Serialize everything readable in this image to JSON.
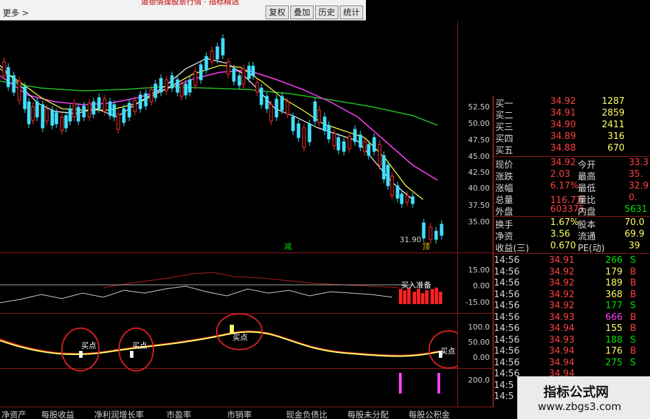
{
  "window": {
    "title": "道德情操股票行情 · 指标精选",
    "more": "更多 >",
    "buttons": [
      "复权",
      "叠加",
      "历史",
      "统计"
    ]
  },
  "price_axis": [
    "52.50",
    "50.00",
    "47.50",
    "45.00",
    "42.50",
    "40.00",
    "37.50",
    "35.00"
  ],
  "indicator_axis": [
    "15.00",
    "0.00",
    "-15.00"
  ],
  "oscillator_axis": [
    "100.0",
    "50.00",
    "0.00"
  ],
  "volume_axis": [
    "200.0"
  ],
  "labels": {
    "min_price": "31.90",
    "marker_green": "减",
    "marker_yellow": "顶",
    "buy_ready": "买入准备",
    "buy_point": "买点"
  },
  "colors": {
    "up": "#ff3030",
    "down": "#40e0ff",
    "ma5": "#ffffff",
    "ma10": "#ffff40",
    "ma20": "#ff40ff",
    "ma60": "#20c020"
  },
  "order_book": [
    {
      "label": "买一",
      "price": "34.92",
      "vol": "1287"
    },
    {
      "label": "买二",
      "price": "34.91",
      "vol": "2859"
    },
    {
      "label": "买三",
      "price": "34.90",
      "vol": "2411"
    },
    {
      "label": "买四",
      "price": "34.89",
      "vol": "316"
    },
    {
      "label": "买五",
      "price": "34.88",
      "vol": "670"
    }
  ],
  "quote": [
    {
      "l1": "现价",
      "v1": "34.92",
      "l2": "今开",
      "v2": "33.3"
    },
    {
      "l1": "涨跌",
      "v1": "2.03",
      "l2": "最高",
      "v2": "35."
    },
    {
      "l1": "涨幅",
      "v1": "6.17%",
      "l2": "最低",
      "v2": "32.9"
    },
    {
      "l1": "总量",
      "v1": "116.7万",
      "l2": "量比",
      "v2": "0."
    },
    {
      "l1": "外盘",
      "v1": "603375",
      "l2": "内盘",
      "v2": "5631"
    }
  ],
  "stats": [
    {
      "l1": "换手",
      "v1": "1.67%",
      "l2": "股本",
      "v2": "70.0"
    },
    {
      "l1": "净资",
      "v1": "3.56",
      "l2": "流通",
      "v2": "69.9"
    },
    {
      "l1": "收益(三)",
      "v1": "0.670",
      "l2": "PE(动)",
      "v2": "39"
    }
  ],
  "ticks": [
    {
      "time": "14:56",
      "price": "34.91",
      "vol": "266",
      "side": "S"
    },
    {
      "time": "14:56",
      "price": "34.92",
      "vol": "179",
      "side": "B"
    },
    {
      "time": "14:56",
      "price": "34.92",
      "vol": "189",
      "side": "B"
    },
    {
      "time": "14:56",
      "price": "34.92",
      "vol": "368",
      "side": "B"
    },
    {
      "time": "14:56",
      "price": "34.92",
      "vol": "177",
      "side": "S"
    },
    {
      "time": "14:56",
      "price": "34.93",
      "vol": "666",
      "side": "B"
    },
    {
      "time": "14:56",
      "price": "34.94",
      "vol": "155",
      "side": "B"
    },
    {
      "time": "14:56",
      "price": "34.93",
      "vol": "188",
      "side": "S"
    },
    {
      "time": "14:56",
      "price": "34.94",
      "vol": "176",
      "side": "B"
    },
    {
      "time": "14:56",
      "price": "34.94",
      "vol": "275",
      "side": "S"
    },
    {
      "time": "14:56",
      "price": "34.94",
      "vol": "",
      "side": ""
    },
    {
      "time": "14:5",
      "price": "",
      "vol": "",
      "side": ""
    },
    {
      "time": "14:5",
      "price": "",
      "vol": "",
      "side": ""
    }
  ],
  "bottom_tabs": [
    "净资产",
    "每股收益",
    "净利润增长率",
    "市盈率",
    "市销率",
    "现金负债比",
    "每股未分配",
    "每股公积金"
  ],
  "watermark": {
    "title": "指标公式网",
    "url": "www.zbgs3.com"
  }
}
